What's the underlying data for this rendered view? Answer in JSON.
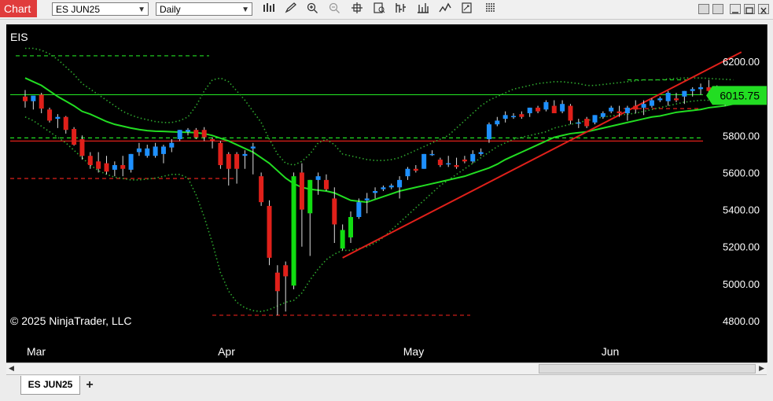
{
  "window": {
    "tab_label": "Chart",
    "instrument": "ES JUN25",
    "period": "Daily"
  },
  "toolbar": {
    "tools": [
      "bar-chart-icon",
      "pencil-icon",
      "zoom-in-icon",
      "zoom-out-icon",
      "crosshair-icon",
      "data-box-icon",
      "bar-style-icon",
      "indicators-icon",
      "strategies-icon",
      "drawing-objects-icon",
      "properties-icon"
    ]
  },
  "window_controls": [
    "minimize-icon",
    "maximize-icon",
    "close-icon"
  ],
  "chart": {
    "symbol_label": "EIS",
    "copyright": "© 2025 NinjaTrader, LLC",
    "price_labels": [
      "6200.00",
      "6000.00",
      "5800.00",
      "5600.00",
      "5400.00",
      "5200.00",
      "5000.00",
      "4800.00"
    ],
    "month_labels": [
      "Mar",
      "Apr",
      "May",
      "Jun"
    ],
    "current_price": "6015.75",
    "colors": {
      "up": "#1e90ff",
      "down": "#e0201a",
      "sma": "#22dd22",
      "bollinger": "#2ea82e",
      "level": "#e0201a",
      "trend": "#e0201a"
    }
  },
  "chart_data": {
    "type": "candlestick",
    "instrument": "ES JUN25",
    "period": "Daily",
    "y_ticks": [
      4800,
      5000,
      5200,
      5400,
      5600,
      5800,
      6000,
      6200
    ],
    "ylim": [
      4710,
      6300
    ],
    "x_ticks": [
      "Mar",
      "Apr",
      "May",
      "Jun"
    ],
    "last_price": 6015.75,
    "bars": [
      {
        "o": 6010,
        "h": 6045,
        "l": 5950,
        "c": 5985
      },
      {
        "o": 5985,
        "h": 6010,
        "l": 5940,
        "c": 6015
      },
      {
        "o": 6020,
        "h": 6030,
        "l": 5920,
        "c": 5945
      },
      {
        "o": 5940,
        "h": 5950,
        "l": 5870,
        "c": 5880
      },
      {
        "o": 5890,
        "h": 5915,
        "l": 5840,
        "c": 5900
      },
      {
        "o": 5900,
        "h": 5905,
        "l": 5810,
        "c": 5830
      },
      {
        "o": 5835,
        "h": 5845,
        "l": 5745,
        "c": 5750
      },
      {
        "o": 5780,
        "h": 5800,
        "l": 5670,
        "c": 5690
      },
      {
        "o": 5690,
        "h": 5710,
        "l": 5620,
        "c": 5640
      },
      {
        "o": 5660,
        "h": 5710,
        "l": 5600,
        "c": 5620
      },
      {
        "o": 5650,
        "h": 5690,
        "l": 5590,
        "c": 5605
      },
      {
        "o": 5615,
        "h": 5660,
        "l": 5580,
        "c": 5640
      },
      {
        "o": 5640,
        "h": 5690,
        "l": 5580,
        "c": 5620
      },
      {
        "o": 5615,
        "h": 5700,
        "l": 5600,
        "c": 5700
      },
      {
        "o": 5710,
        "h": 5760,
        "l": 5690,
        "c": 5730
      },
      {
        "o": 5690,
        "h": 5750,
        "l": 5680,
        "c": 5730
      },
      {
        "o": 5690,
        "h": 5760,
        "l": 5680,
        "c": 5740
      },
      {
        "o": 5700,
        "h": 5750,
        "l": 5650,
        "c": 5740
      },
      {
        "o": 5735,
        "h": 5780,
        "l": 5710,
        "c": 5760
      },
      {
        "o": 5780,
        "h": 5830,
        "l": 5770,
        "c": 5830
      },
      {
        "o": 5820,
        "h": 5840,
        "l": 5800,
        "c": 5830
      },
      {
        "o": 5830,
        "h": 5840,
        "l": 5780,
        "c": 5790
      },
      {
        "o": 5830,
        "h": 5845,
        "l": 5770,
        "c": 5790
      },
      {
        "o": 5780,
        "h": 5790,
        "l": 5730,
        "c": 5770
      },
      {
        "o": 5760,
        "h": 5770,
        "l": 5620,
        "c": 5640
      },
      {
        "o": 5700,
        "h": 5710,
        "l": 5530,
        "c": 5620
      },
      {
        "o": 5700,
        "h": 5710,
        "l": 5540,
        "c": 5620
      },
      {
        "o": 5690,
        "h": 5720,
        "l": 5620,
        "c": 5700
      },
      {
        "o": 5730,
        "h": 5760,
        "l": 5590,
        "c": 5740
      },
      {
        "o": 5580,
        "h": 5600,
        "l": 5420,
        "c": 5440
      },
      {
        "o": 5420,
        "h": 5450,
        "l": 5100,
        "c": 5140
      },
      {
        "o": 5060,
        "h": 5100,
        "l": 4830,
        "c": 4960
      },
      {
        "o": 5100,
        "h": 5120,
        "l": 4850,
        "c": 5040
      },
      {
        "o": 4990,
        "h": 5600,
        "l": 4970,
        "c": 5580
      },
      {
        "o": 5600,
        "h": 5650,
        "l": 5200,
        "c": 5400
      },
      {
        "o": 5380,
        "h": 5560,
        "l": 5150,
        "c": 5560
      },
      {
        "o": 5560,
        "h": 5600,
        "l": 5480,
        "c": 5580
      },
      {
        "o": 5560,
        "h": 5590,
        "l": 5500,
        "c": 5510
      },
      {
        "o": 5460,
        "h": 5520,
        "l": 5220,
        "c": 5320
      },
      {
        "o": 5190,
        "h": 5320,
        "l": 5180,
        "c": 5290
      },
      {
        "o": 5250,
        "h": 5390,
        "l": 5220,
        "c": 5360
      },
      {
        "o": 5360,
        "h": 5460,
        "l": 5350,
        "c": 5440
      },
      {
        "o": 5450,
        "h": 5490,
        "l": 5380,
        "c": 5460
      },
      {
        "o": 5490,
        "h": 5520,
        "l": 5460,
        "c": 5500
      },
      {
        "o": 5510,
        "h": 5530,
        "l": 5500,
        "c": 5520
      },
      {
        "o": 5520,
        "h": 5540,
        "l": 5510,
        "c": 5530
      },
      {
        "o": 5520,
        "h": 5580,
        "l": 5460,
        "c": 5560
      },
      {
        "o": 5580,
        "h": 5630,
        "l": 5560,
        "c": 5620
      },
      {
        "o": 5620,
        "h": 5640,
        "l": 5600,
        "c": 5610
      },
      {
        "o": 5620,
        "h": 5700,
        "l": 5620,
        "c": 5700
      },
      {
        "o": 5700,
        "h": 5720,
        "l": 5690,
        "c": 5700
      },
      {
        "o": 5670,
        "h": 5680,
        "l": 5630,
        "c": 5640
      },
      {
        "o": 5650,
        "h": 5690,
        "l": 5630,
        "c": 5650
      },
      {
        "o": 5640,
        "h": 5680,
        "l": 5620,
        "c": 5630
      },
      {
        "o": 5670,
        "h": 5690,
        "l": 5650,
        "c": 5660
      },
      {
        "o": 5660,
        "h": 5720,
        "l": 5650,
        "c": 5700
      },
      {
        "o": 5700,
        "h": 5730,
        "l": 5690,
        "c": 5710
      },
      {
        "o": 5780,
        "h": 5870,
        "l": 5760,
        "c": 5860
      },
      {
        "o": 5860,
        "h": 5900,
        "l": 5850,
        "c": 5880
      },
      {
        "o": 5890,
        "h": 5930,
        "l": 5870,
        "c": 5910
      },
      {
        "o": 5900,
        "h": 5920,
        "l": 5890,
        "c": 5905
      },
      {
        "o": 5915,
        "h": 5930,
        "l": 5890,
        "c": 5900
      },
      {
        "o": 5920,
        "h": 5950,
        "l": 5900,
        "c": 5950
      },
      {
        "o": 5950,
        "h": 5960,
        "l": 5920,
        "c": 5930
      },
      {
        "o": 5940,
        "h": 5990,
        "l": 5930,
        "c": 5980
      },
      {
        "o": 5960,
        "h": 5990,
        "l": 5920,
        "c": 5920
      },
      {
        "o": 5930,
        "h": 5990,
        "l": 5920,
        "c": 5970
      },
      {
        "o": 5960,
        "h": 5970,
        "l": 5860,
        "c": 5880
      },
      {
        "o": 5870,
        "h": 5890,
        "l": 5840,
        "c": 5870
      },
      {
        "o": 5890,
        "h": 5900,
        "l": 5840,
        "c": 5850
      },
      {
        "o": 5870,
        "h": 5910,
        "l": 5860,
        "c": 5910
      },
      {
        "o": 5900,
        "h": 5930,
        "l": 5890,
        "c": 5920
      },
      {
        "o": 5930,
        "h": 5960,
        "l": 5920,
        "c": 5950
      },
      {
        "o": 5930,
        "h": 5960,
        "l": 5900,
        "c": 5920
      },
      {
        "o": 5920,
        "h": 5960,
        "l": 5880,
        "c": 5950
      },
      {
        "o": 5960,
        "h": 5990,
        "l": 5920,
        "c": 5940
      },
      {
        "o": 5950,
        "h": 5990,
        "l": 5910,
        "c": 5970
      },
      {
        "o": 5960,
        "h": 6000,
        "l": 5950,
        "c": 5990
      },
      {
        "o": 5990,
        "h": 6010,
        "l": 5980,
        "c": 6000
      },
      {
        "o": 5985,
        "h": 6040,
        "l": 5960,
        "c": 6030
      },
      {
        "o": 6000,
        "h": 6030,
        "l": 5980,
        "c": 5990
      },
      {
        "o": 6010,
        "h": 6040,
        "l": 5970,
        "c": 6040
      },
      {
        "o": 6040,
        "h": 6060,
        "l": 6010,
        "c": 6050
      },
      {
        "o": 6050,
        "h": 6080,
        "l": 6020,
        "c": 6060
      },
      {
        "o": 6060,
        "h": 6100,
        "l": 6020,
        "c": 6040
      },
      {
        "o": 6050,
        "h": 6070,
        "l": 6010,
        "c": 6035
      },
      {
        "o": 6040,
        "h": 6050,
        "l": 5960,
        "c": 5990
      },
      {
        "o": 6030,
        "h": 6040,
        "l": 5975,
        "c": 6015.75
      }
    ],
    "sma": [
      6110,
      6090,
      6070,
      6040,
      6010,
      5985,
      5960,
      5930,
      5915,
      5895,
      5875,
      5860,
      5850,
      5840,
      5832,
      5826,
      5823,
      5822,
      5820,
      5818,
      5817,
      5815,
      5810,
      5800,
      5785,
      5770,
      5750,
      5730,
      5710,
      5680,
      5650,
      5610,
      5570,
      5540,
      5520,
      5510,
      5505,
      5500,
      5490,
      5470,
      5450,
      5445,
      5440,
      5455,
      5470,
      5485,
      5500,
      5510,
      5520,
      5530,
      5540,
      5550,
      5560,
      5570,
      5580,
      5595,
      5610,
      5625,
      5645,
      5670,
      5690,
      5710,
      5730,
      5750,
      5770,
      5790,
      5800,
      5810,
      5815,
      5820,
      5830,
      5840,
      5850,
      5860,
      5870,
      5880,
      5890,
      5900,
      5905,
      5915,
      5925,
      5930,
      5935,
      5940,
      5950,
      5955,
      5960,
      5970
    ],
    "levels": [
      {
        "price": 6020,
        "style": "solid",
        "color": "#22dd22"
      },
      {
        "price": 5770,
        "style": "solid",
        "color": "#e0201a"
      },
      {
        "price": 6230,
        "style": "dashed",
        "color": "#22dd22"
      },
      {
        "price": 5787,
        "style": "dashed",
        "color": "#22dd22"
      },
      {
        "price": 5568,
        "style": "dashed",
        "color": "#e0201a"
      },
      {
        "price": 4830,
        "style": "dashed",
        "color": "#e0201a"
      },
      {
        "price": 6100,
        "style": "dashed",
        "color": "#22dd22"
      },
      {
        "price": 5945,
        "style": "dashed",
        "color": "#e0201a"
      }
    ],
    "trendline": {
      "from": [
        39,
        5140
      ],
      "to": [
        88,
        6250
      ]
    },
    "bollinger_upper": [
      6270,
      6270,
      6260,
      6240,
      6210,
      6170,
      6130,
      6080,
      6050,
      6020,
      5990,
      5960,
      5930,
      5910,
      5895,
      5885,
      5875,
      5870,
      5870,
      5880,
      5900,
      5960,
      6040,
      6100,
      6110,
      6090,
      6040,
      5990,
      5930,
      5870,
      5780,
      5700,
      5650,
      5640,
      5660,
      5700,
      5760,
      5780,
      5750,
      5700,
      5690,
      5680,
      5670,
      5665,
      5665,
      5670,
      5680,
      5700,
      5720,
      5740,
      5760,
      5780,
      5800,
      5840,
      5880,
      5920,
      5960,
      5990,
      6010,
      6030,
      6050,
      6060,
      6070,
      6080,
      6085,
      6090,
      6090,
      6085,
      6080,
      6070,
      6070,
      6075,
      6080,
      6085,
      6090,
      6095,
      6100,
      6100,
      6100,
      6105,
      6108,
      6110,
      6110,
      6110,
      6108,
      6105,
      6103,
      6100
    ],
    "bollinger_lower": [
      5900,
      5880,
      5850,
      5820,
      5790,
      5760,
      5720,
      5680,
      5640,
      5610,
      5590,
      5575,
      5568,
      5560,
      5560,
      5565,
      5570,
      5580,
      5590,
      5590,
      5570,
      5480,
      5360,
      5220,
      5060,
      4960,
      4900,
      4870,
      4855,
      4850,
      4860,
      4880,
      4900,
      4910,
      4950,
      5020,
      5080,
      5130,
      5160,
      5180,
      5180,
      5190,
      5200,
      5220,
      5250,
      5290,
      5330,
      5370,
      5410,
      5450,
      5490,
      5530,
      5560,
      5590,
      5620,
      5650,
      5680,
      5710,
      5740,
      5760,
      5780,
      5790,
      5800,
      5810,
      5820,
      5840,
      5850,
      5860,
      5870,
      5880,
      5890,
      5900,
      5905,
      5910,
      5915,
      5920,
      5930,
      5940,
      5950,
      5960,
      5970,
      5980,
      5985,
      5990,
      5990,
      5985,
      5980,
      5975
    ]
  }
}
